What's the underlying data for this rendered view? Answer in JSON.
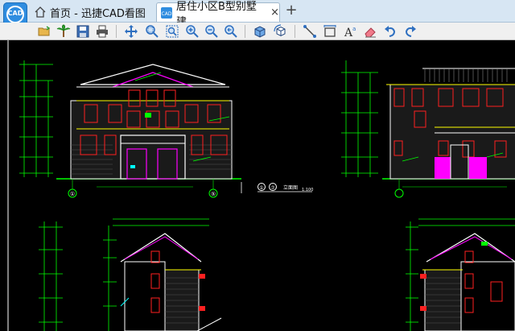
{
  "app": {
    "logo_text": "CAD",
    "brand_color": "#2f8de0"
  },
  "tabs": {
    "home": {
      "label": "首页 - 迅捷CAD看图",
      "icon": "home-icon"
    },
    "file": {
      "label": "居住小区B型别墅建...",
      "icon": "cad-file-icon",
      "close": "×"
    },
    "new_tab": "+"
  },
  "toolbar": {
    "buttons": [
      {
        "name": "open-folder",
        "icon": "open-folder-icon"
      },
      {
        "name": "palm-tree",
        "icon": "palm-tree-icon"
      },
      {
        "name": "save",
        "icon": "save-icon"
      },
      {
        "name": "print",
        "icon": "print-icon"
      },
      {
        "name": "pan",
        "icon": "pan-icon"
      },
      {
        "name": "zoom-window",
        "icon": "zoom-window-icon"
      },
      {
        "name": "zoom-extents",
        "icon": "zoom-extents-icon"
      },
      {
        "name": "zoom-in",
        "icon": "zoom-in-icon"
      },
      {
        "name": "zoom-out",
        "icon": "zoom-out-icon"
      },
      {
        "name": "zoom-previous",
        "icon": "zoom-previous-icon"
      },
      {
        "name": "3d-view",
        "icon": "cube-icon"
      },
      {
        "name": "3d-orbit",
        "icon": "cube-rotate-icon"
      },
      {
        "name": "measure-distance",
        "icon": "measure-line-icon"
      },
      {
        "name": "measure-area",
        "icon": "dimension-icon"
      },
      {
        "name": "text",
        "icon": "text-icon"
      },
      {
        "name": "erase",
        "icon": "eraser-icon"
      },
      {
        "name": "undo",
        "icon": "undo-icon"
      },
      {
        "name": "redo",
        "icon": "redo-icon"
      }
    ]
  },
  "drawing": {
    "elevation_title": "立面图",
    "scale": "1:100",
    "axis_labels": [
      "①",
      "⑤",
      "⑦"
    ],
    "colors": {
      "background": "#000000",
      "dimension": "#00ff00",
      "window": "#ff2020",
      "wall": "#ff00ff",
      "structure": "#ffffff",
      "accent": "#ffff00",
      "cyan": "#00ffff"
    }
  }
}
